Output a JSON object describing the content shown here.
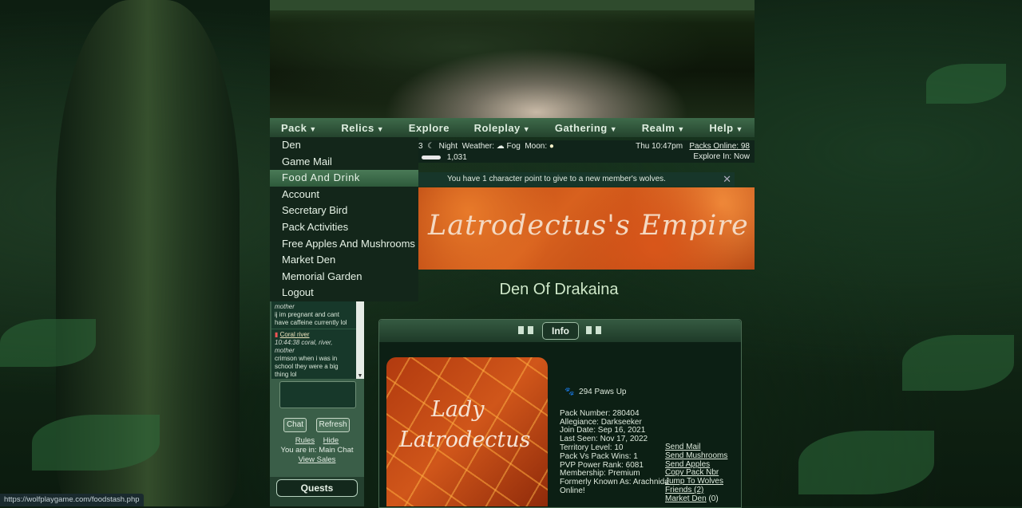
{
  "nav": {
    "items": [
      "Pack",
      "Relics",
      "Explore",
      "Roleplay",
      "Gathering",
      "Realm",
      "Help"
    ],
    "has_caret": [
      true,
      true,
      false,
      true,
      true,
      true,
      true
    ]
  },
  "dropdown": {
    "items": [
      "Den",
      "Game Mail",
      "Food And Drink",
      "Account",
      "Secretary Bird",
      "Pack Activities",
      "Free Apples And Mushrooms",
      "Market Den",
      "Memorial Garden",
      "Logout"
    ],
    "active_index": 2
  },
  "status": {
    "prefix": "3",
    "time_of_day": "Night",
    "weather_label": "Weather:",
    "weather": "Fog",
    "moon_label": "Moon:",
    "bones": "1,031",
    "clock": "Thu 10:47pm",
    "packs_online": "Packs Online: 98",
    "explore_in": "Explore In: Now"
  },
  "notice": {
    "text": "You have 1 character point to give to a new member's wolves.",
    "close": "✕"
  },
  "pack": {
    "banner_name": "Latrodectus's Empire",
    "den_title": "Den Of Drakaina",
    "portrait_line1": "Lady",
    "portrait_line2": "Latrodectus"
  },
  "info": {
    "tab_label": "Info",
    "paws_up": "294 Paws Up",
    "stats": [
      "Pack Number: 280404",
      "Allegiance: Darkseeker",
      "Join Date: Sep 16, 2021",
      "Last Seen: Nov 17, 2022",
      "Territory Level: 10",
      "Pack Vs Pack Wins: 1",
      "PVP Power Rank: 6081",
      "Membership: Premium",
      "Formerly Known As: Arachnida",
      "Online!"
    ],
    "links": [
      {
        "label": "Send Mail",
        "suffix": ""
      },
      {
        "label": "Send Mushrooms",
        "suffix": ""
      },
      {
        "label": "Send Apples",
        "suffix": ""
      },
      {
        "label": "Copy Pack Nbr",
        "suffix": ""
      },
      {
        "label": "Jump To Wolves",
        "suffix": ""
      },
      {
        "label": "Friends (2)",
        "suffix": ""
      },
      {
        "label": "Market Den",
        "suffix": " (0)"
      }
    ]
  },
  "chat": {
    "messages": [
      {
        "meta": "mother",
        "text": "ij im pregnant and cant have caffeine currently lol"
      },
      {
        "who": "Coral river",
        "meta": "10:44:38 coral, river, mother",
        "text": "crimson when i was in school they were a big thing lol"
      }
    ],
    "chat_button": "Chat",
    "refresh_button": "Refresh",
    "rules": "Rules",
    "hide": "Hide",
    "location": "You are in: Main Chat",
    "view_sales": "View Sales"
  },
  "quests_label": "Quests",
  "status_url": "https://wolfplaygame.com/foodstash.php"
}
